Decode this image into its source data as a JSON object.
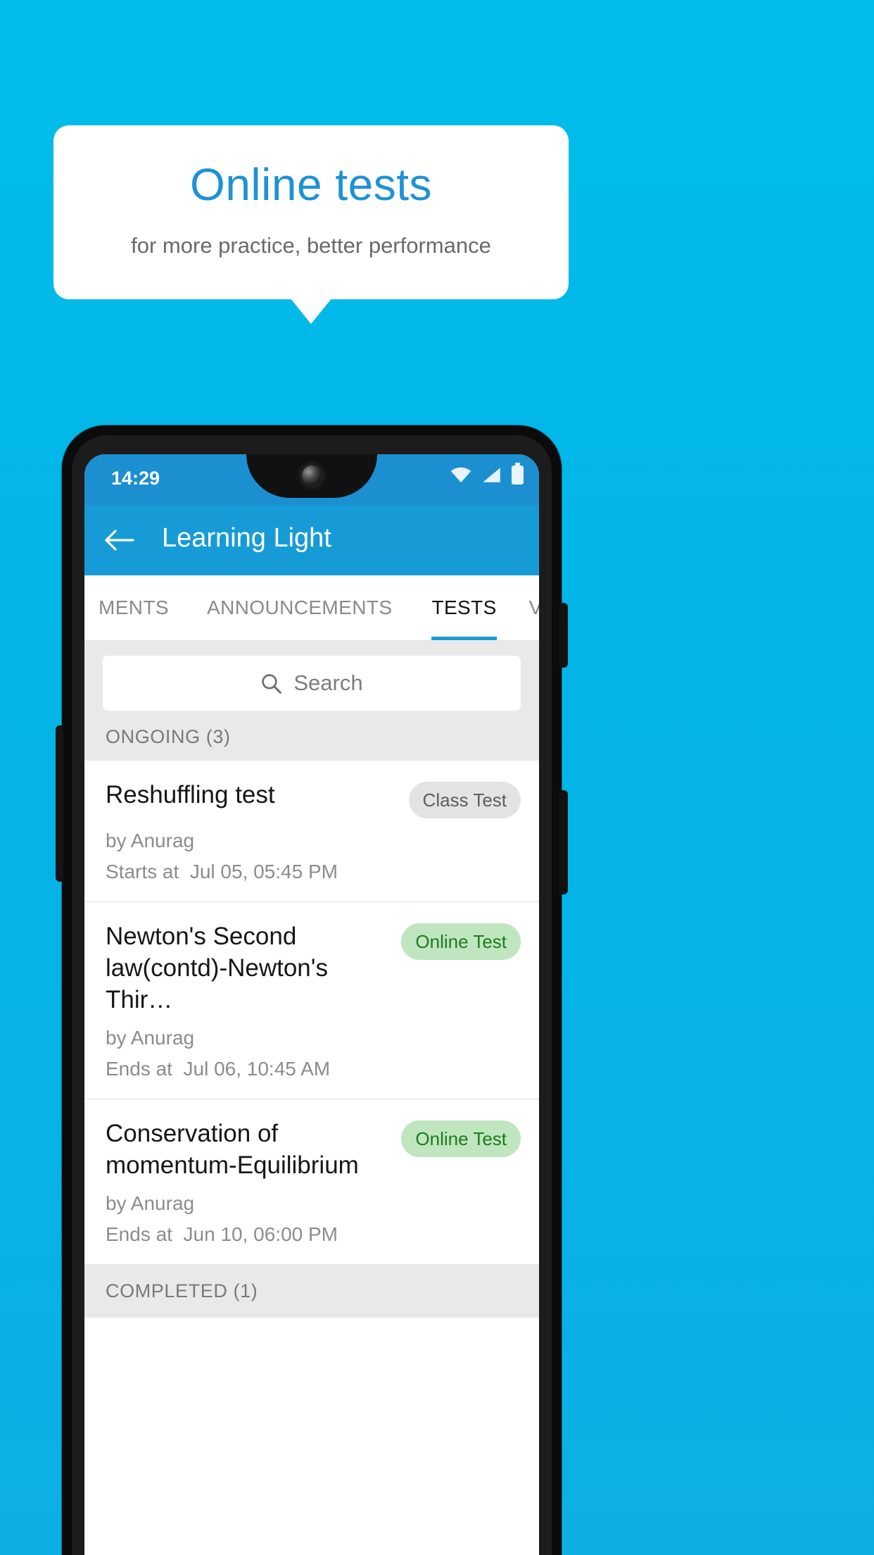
{
  "promo": {
    "title": "Online tests",
    "subtitle": "for more practice, better performance",
    "background_color": "#00BCEB",
    "title_color": "#1E92D5",
    "card_color": "#FFFFFF"
  },
  "phone": {
    "status_bar": {
      "time": "14:29",
      "icons": [
        "wifi-icon",
        "signal-icon",
        "battery-icon"
      ],
      "background_color": "#1B8FD0"
    },
    "app_bar": {
      "back_icon": "back-arrow-icon",
      "title": "Learning Light",
      "background_color": "#169BD7"
    },
    "tabs": [
      {
        "label": "MENTS",
        "active": false
      },
      {
        "label": "ANNOUNCEMENTS",
        "active": false
      },
      {
        "label": "TESTS",
        "active": true
      },
      {
        "label": "VIDEOS",
        "active": false
      }
    ],
    "tab_indicator_color": "#1B9BD6",
    "search": {
      "icon": "search-icon",
      "placeholder": "Search",
      "value": ""
    },
    "sections": [
      {
        "header": "ONGOING (3)",
        "items": [
          {
            "title": "Reshuffling test",
            "badge": "Class Test",
            "badge_style": "grey",
            "author": "by Anurag",
            "time_label": "Starts at",
            "time_value": "Jul 05, 05:45 PM"
          },
          {
            "title": "Newton's Second law(contd)-Newton's Thir…",
            "badge": "Online Test",
            "badge_style": "green",
            "author": "by Anurag",
            "time_label": "Ends at",
            "time_value": "Jul 06, 10:45 AM"
          },
          {
            "title": "Conservation of momentum-Equilibrium",
            "badge": "Online Test",
            "badge_style": "green",
            "author": "by Anurag",
            "time_label": "Ends at",
            "time_value": "Jun 10, 06:00 PM"
          }
        ]
      },
      {
        "header": "COMPLETED (1)",
        "items": []
      }
    ]
  }
}
